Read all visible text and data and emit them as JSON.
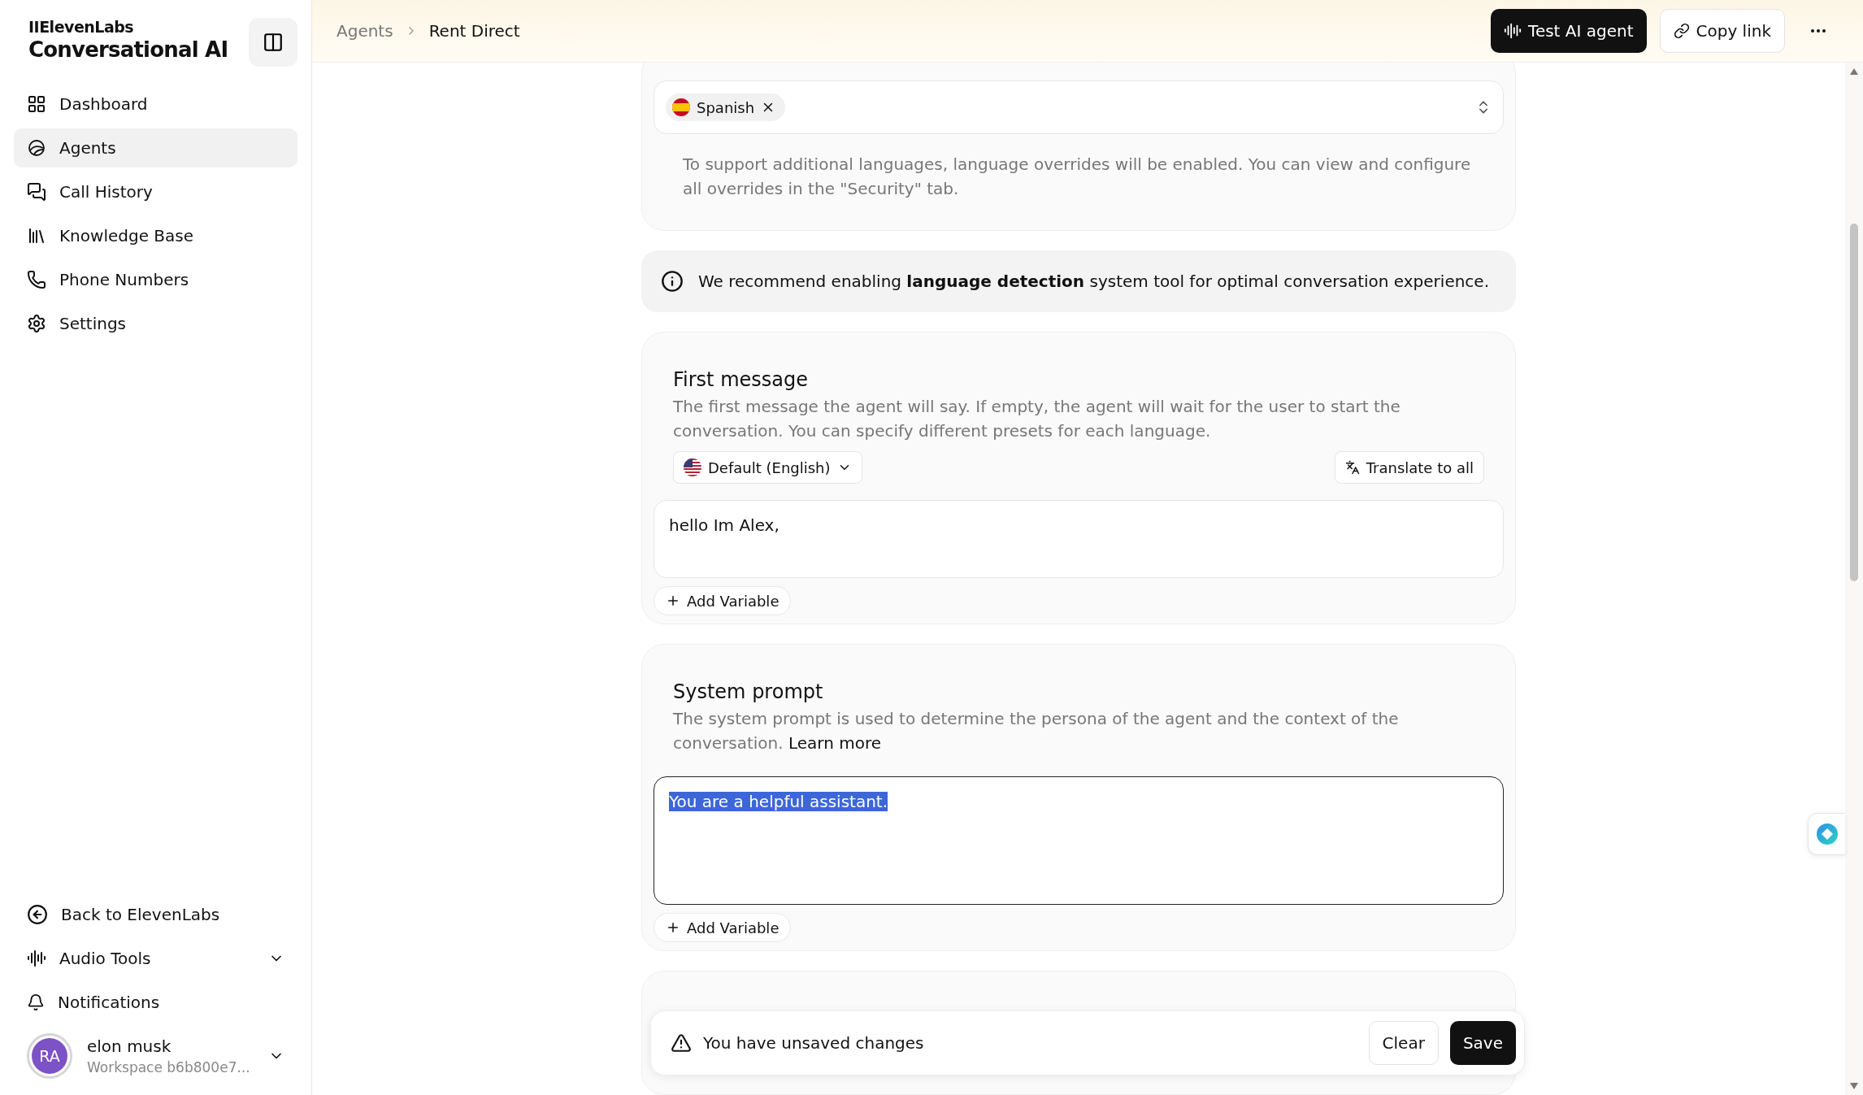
{
  "sidebar": {
    "brand": "IIElevenLabs",
    "product": "Conversational AI",
    "nav": [
      {
        "label": "Dashboard",
        "selected": false
      },
      {
        "label": "Agents",
        "selected": true
      },
      {
        "label": "Call History",
        "selected": false
      },
      {
        "label": "Knowledge Base",
        "selected": false
      },
      {
        "label": "Phone Numbers",
        "selected": false
      },
      {
        "label": "Settings",
        "selected": false
      }
    ],
    "footer": [
      {
        "label": "Back to ElevenLabs",
        "expandable": false
      },
      {
        "label": "Audio Tools",
        "expandable": true
      },
      {
        "label": "Notifications",
        "expandable": false
      }
    ],
    "user": {
      "initials": "RA",
      "name": "elon musk",
      "workspace": "Workspace b6b800e7..."
    }
  },
  "header": {
    "breadcrumbs": [
      "Agents",
      "Rent Direct"
    ],
    "test_button": "Test AI agent",
    "copy_button": "Copy link"
  },
  "language": {
    "tags": [
      {
        "label": "Spanish"
      }
    ],
    "help": "To support additional languages, language overrides will be enabled. You can view and configure all overrides in the \"Security\" tab."
  },
  "notice": "We recommend enabling **language detection** system tool for optimal conversation experience.",
  "first_message": {
    "title": "First message",
    "description": "The first message the agent will say. If empty, the agent will wait for the user to start the conversation. You can specify different presets for each language.",
    "language": "Default (English)",
    "translate": "Translate to all",
    "value": "hello Im Alex,",
    "add_variable": "Add Variable",
    "focused": false,
    "highlighted": false
  },
  "system_prompt": {
    "title": "System prompt",
    "description": "The system prompt is used to determine the persona of the agent and the context of the conversation.",
    "link": "Learn more",
    "value": "You are a helpful assistant.",
    "add_variable": "Add Variable",
    "focused": true,
    "highlighted": true
  },
  "unsaved": {
    "message": "You have unsaved changes",
    "clear": "Clear",
    "save": "Save"
  }
}
